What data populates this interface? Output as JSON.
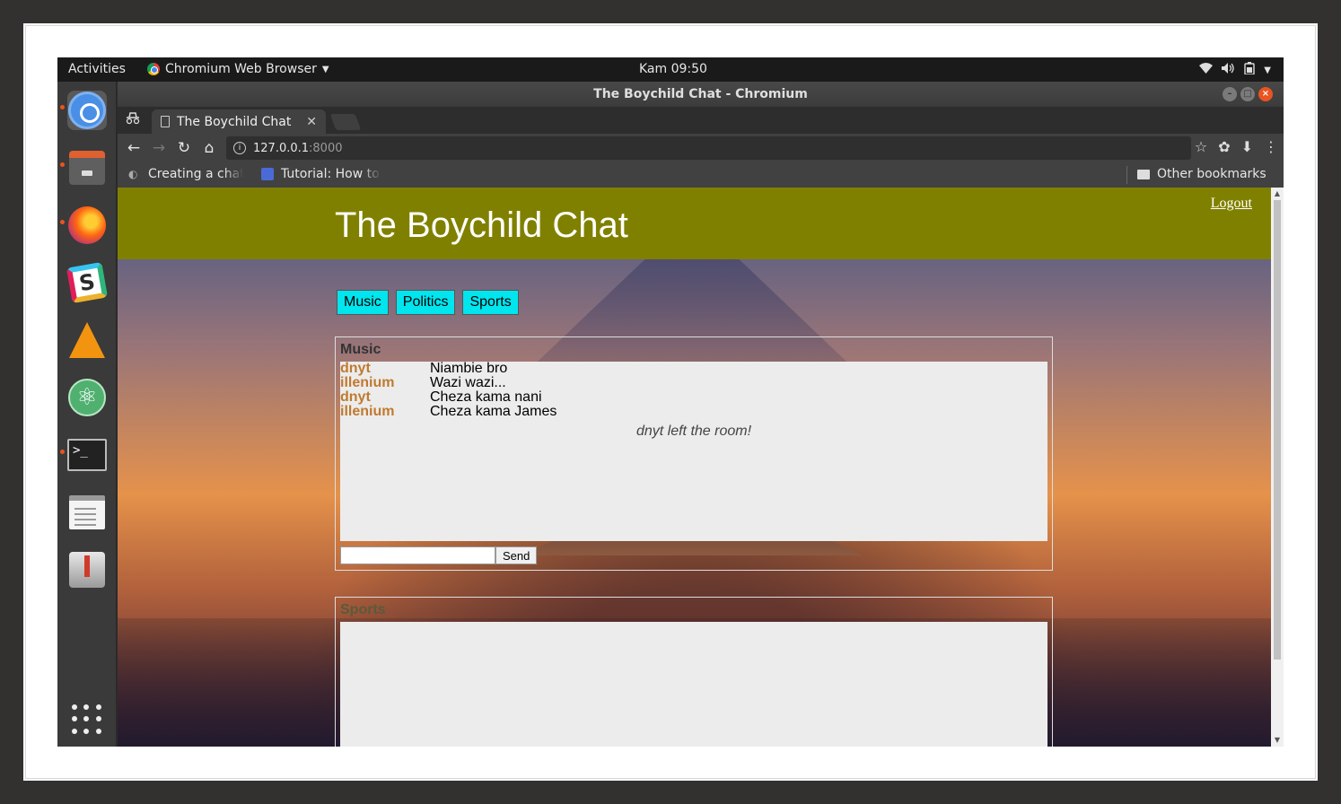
{
  "system": {
    "activities": "Activities",
    "app_menu": "Chromium Web Browser",
    "clock": "Kam 09:50"
  },
  "window": {
    "title": "The Boychild Chat - Chromium"
  },
  "tab": {
    "title": "The Boychild Chat"
  },
  "address": {
    "host": "127.0.0.1",
    "port": ":8000"
  },
  "bookmarks": {
    "items": [
      "Creating a chat",
      "Tutorial: How to"
    ],
    "other": "Other bookmarks"
  },
  "page": {
    "site_title": "The Boychild Chat",
    "logout": "Logout",
    "rooms": [
      "Music",
      "Politics",
      "Sports"
    ],
    "music_room": {
      "name": "Music",
      "messages": [
        {
          "user": "dnyt",
          "text": "Niambie bro"
        },
        {
          "user": "illenium",
          "text": "Wazi wazi..."
        },
        {
          "user": "dnyt",
          "text": "Cheza kama nani"
        },
        {
          "user": "illenium",
          "text": "Cheza kama James"
        }
      ],
      "system_message": "dnyt left the room!",
      "send_label": "Send"
    },
    "sports_room": {
      "name": "Sports"
    }
  },
  "colors": {
    "header_bg": "#808000",
    "room_button": "#00e5ee",
    "username": "#c07a2f",
    "ubuntu_accent": "#e95420"
  }
}
